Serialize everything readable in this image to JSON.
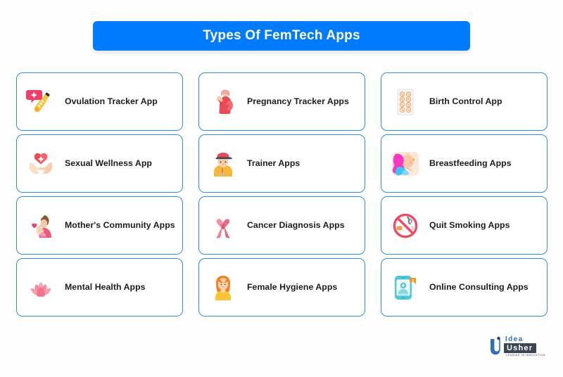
{
  "header": {
    "title": "Types Of FemTech Apps",
    "background_color": "#007bfc",
    "text_color": "#ffffff"
  },
  "theme": {
    "page_background": "#fefefe",
    "card_background": "#ffffff",
    "card_border_color": "#2f90d8",
    "label_color": "#1b1b1b",
    "accent_pink": "#f2728c",
    "accent_blue": "#007bfc"
  },
  "grid": {
    "columns": 3,
    "rows": 4,
    "cards": [
      {
        "label": "Ovulation Tracker App",
        "icon": "ovulation-thermometer-icon"
      },
      {
        "label": "Pregnancy Tracker Apps",
        "icon": "pregnant-woman-icon"
      },
      {
        "label": "Birth Control App",
        "icon": "pill-blister-pack-icon"
      },
      {
        "label": "Sexual Wellness App",
        "icon": "heart-in-hands-icon"
      },
      {
        "label": "Trainer Apps",
        "icon": "trainer-person-icon"
      },
      {
        "label": "Breastfeeding Apps",
        "icon": "breastfeeding-mother-icon"
      },
      {
        "label": "Mother's Community Apps",
        "icon": "mother-and-baby-icon"
      },
      {
        "label": "Cancer Diagnosis Apps",
        "icon": "pink-awareness-ribbon-icon"
      },
      {
        "label": "Quit Smoking Apps",
        "icon": "no-smoking-icon"
      },
      {
        "label": "Mental Health Apps",
        "icon": "lotus-flower-icon"
      },
      {
        "label": "Female Hygiene Apps",
        "icon": "female-avatar-icon"
      },
      {
        "label": "Online Consulting Apps",
        "icon": "phone-doctor-consult-icon"
      }
    ]
  },
  "logo": {
    "mark": "U",
    "name_top": "Idea",
    "name_bottom": "Usher",
    "tagline": "LEADING IN INNOVATION"
  }
}
